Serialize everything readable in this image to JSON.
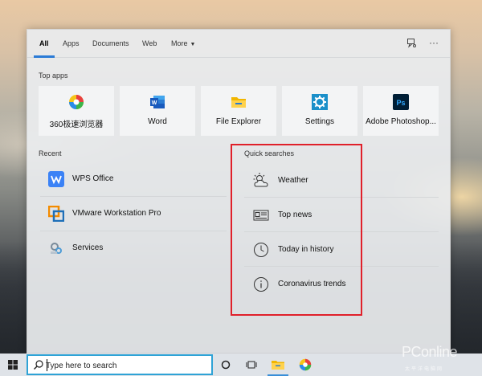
{
  "tabs": [
    {
      "label": "All"
    },
    {
      "label": "Apps"
    },
    {
      "label": "Documents"
    },
    {
      "label": "Web"
    },
    {
      "label": "More"
    }
  ],
  "top_apps": {
    "heading": "Top apps",
    "items": [
      {
        "label": "360极速浏览器",
        "icon": "360-browser-icon"
      },
      {
        "label": "Word",
        "icon": "word-icon"
      },
      {
        "label": "File Explorer",
        "icon": "folder-icon"
      },
      {
        "label": "Settings",
        "icon": "gear-icon"
      },
      {
        "label": "Adobe Photoshop...",
        "icon": "photoshop-icon"
      }
    ]
  },
  "recent": {
    "heading": "Recent",
    "items": [
      {
        "label": "WPS Office",
        "icon": "wps-icon"
      },
      {
        "label": "VMware Workstation Pro",
        "icon": "vmware-icon"
      },
      {
        "label": "Services",
        "icon": "services-icon"
      }
    ]
  },
  "quick_searches": {
    "heading": "Quick searches",
    "items": [
      {
        "label": "Weather",
        "icon": "weather-icon"
      },
      {
        "label": "Top news",
        "icon": "news-icon"
      },
      {
        "label": "Today in history",
        "icon": "clock-icon"
      },
      {
        "label": "Coronavirus trends",
        "icon": "info-icon"
      }
    ]
  },
  "taskbar": {
    "search_placeholder": "Type here to search"
  },
  "watermark": {
    "text": "PConline",
    "subtext": "太平洋电脑网"
  },
  "colors": {
    "accent": "#2b7bd6",
    "highlight": "#e0202a",
    "search_border": "#2fa3d6"
  }
}
